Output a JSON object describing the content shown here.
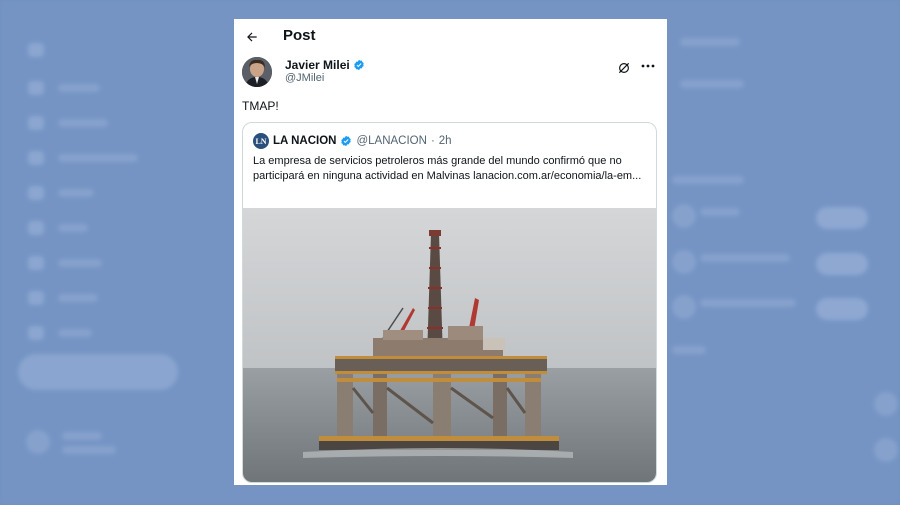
{
  "header": {
    "title": "Post"
  },
  "post": {
    "author_name": "Javier Milei",
    "author_handle": "@JMilei",
    "text": "TMAP!"
  },
  "quoted": {
    "author_name": "LA NACION",
    "author_handle": "@LANACION",
    "separator": "·",
    "time": "2h",
    "logo_text": "LN",
    "text": "La empresa de servicios petroleros más grande del mundo confirmó que no participará en ninguna actividad en Malvinas lanacion.com.ar/economia/la-em..."
  },
  "icons": {
    "back": "arrow-left-icon",
    "verified": "verified-badge-icon",
    "grok": "grok-icon",
    "more": "more-icon"
  },
  "colors": {
    "page_bg": "#7594c4",
    "card_bg": "#ffffff",
    "verified": "#1d9bf0",
    "text_primary": "#0f1419",
    "text_secondary": "#536471"
  }
}
